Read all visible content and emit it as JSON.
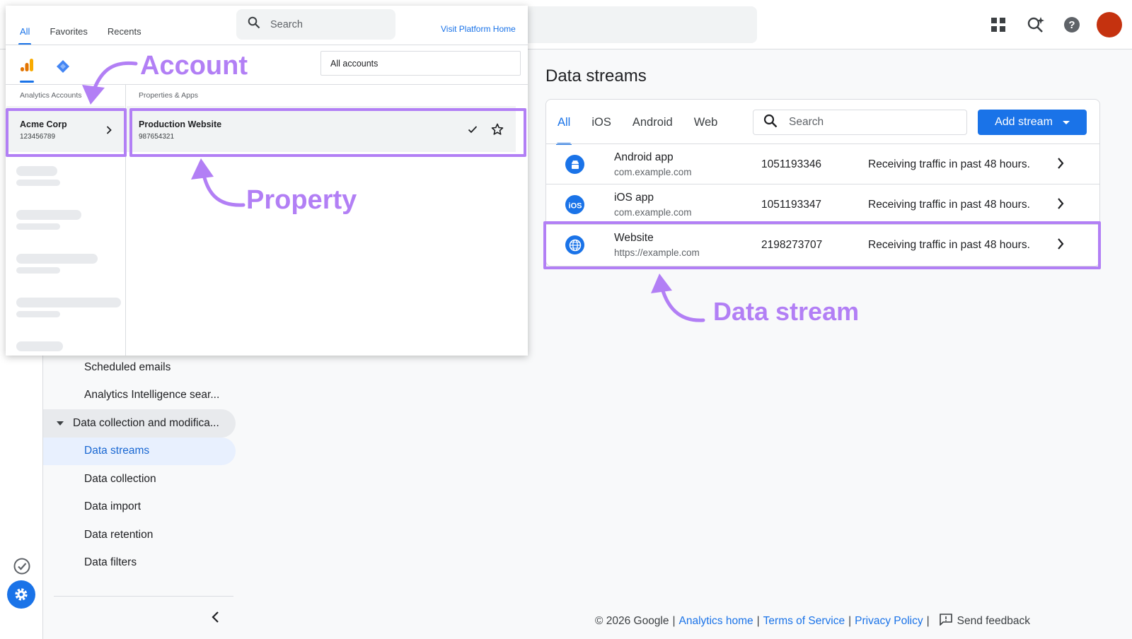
{
  "topbar": {
    "icons": [
      "apps-grid-icon",
      "search-spark-icon",
      "help-icon",
      "avatar"
    ],
    "avatar_color": "#c5320f"
  },
  "popup": {
    "tabs": [
      "All",
      "Favorites",
      "Recents"
    ],
    "search_placeholder": "Search",
    "visit_link": "Visit Platform Home",
    "account_filter": "All accounts",
    "accounts_header": "Analytics Accounts",
    "properties_header": "Properties & Apps",
    "account": {
      "name": "Acme Corp",
      "id": "123456789"
    },
    "property": {
      "name": "Production Website",
      "id": "987654321"
    }
  },
  "annotations": {
    "account": "Account",
    "property": "Property",
    "data_stream": "Data stream",
    "color": "#b27ff5"
  },
  "nav": {
    "items": [
      {
        "label": "Scheduled emails"
      },
      {
        "label": "Analytics Intelligence sear..."
      },
      {
        "label": "Data collection and modifica..."
      },
      {
        "label": "Data streams"
      },
      {
        "label": "Data collection"
      },
      {
        "label": "Data import"
      },
      {
        "label": "Data retention"
      },
      {
        "label": "Data filters"
      }
    ]
  },
  "main": {
    "title": "Data streams",
    "tabs": [
      "All",
      "iOS",
      "Android",
      "Web"
    ],
    "search_placeholder": "Search",
    "add_button": "Add stream",
    "streams": [
      {
        "icon": "android-icon",
        "name": "Android app",
        "sub": "com.example.com",
        "id": "1051193346",
        "status": "Receiving traffic in past 48 hours."
      },
      {
        "icon": "ios-icon",
        "name": "iOS app",
        "sub": "com.example.com",
        "id": "1051193347",
        "status": "Receiving traffic in past 48 hours."
      },
      {
        "icon": "globe-icon",
        "name": "Website",
        "sub": "https://example.com",
        "id": "2198273707",
        "status": "Receiving traffic in past 48 hours."
      }
    ]
  },
  "footer": {
    "copyright": "© 2026 Google",
    "links": [
      "Analytics home",
      "Terms of Service",
      "Privacy Policy"
    ],
    "feedback": "Send feedback"
  },
  "colors": {
    "accent": "#1a73e8"
  }
}
